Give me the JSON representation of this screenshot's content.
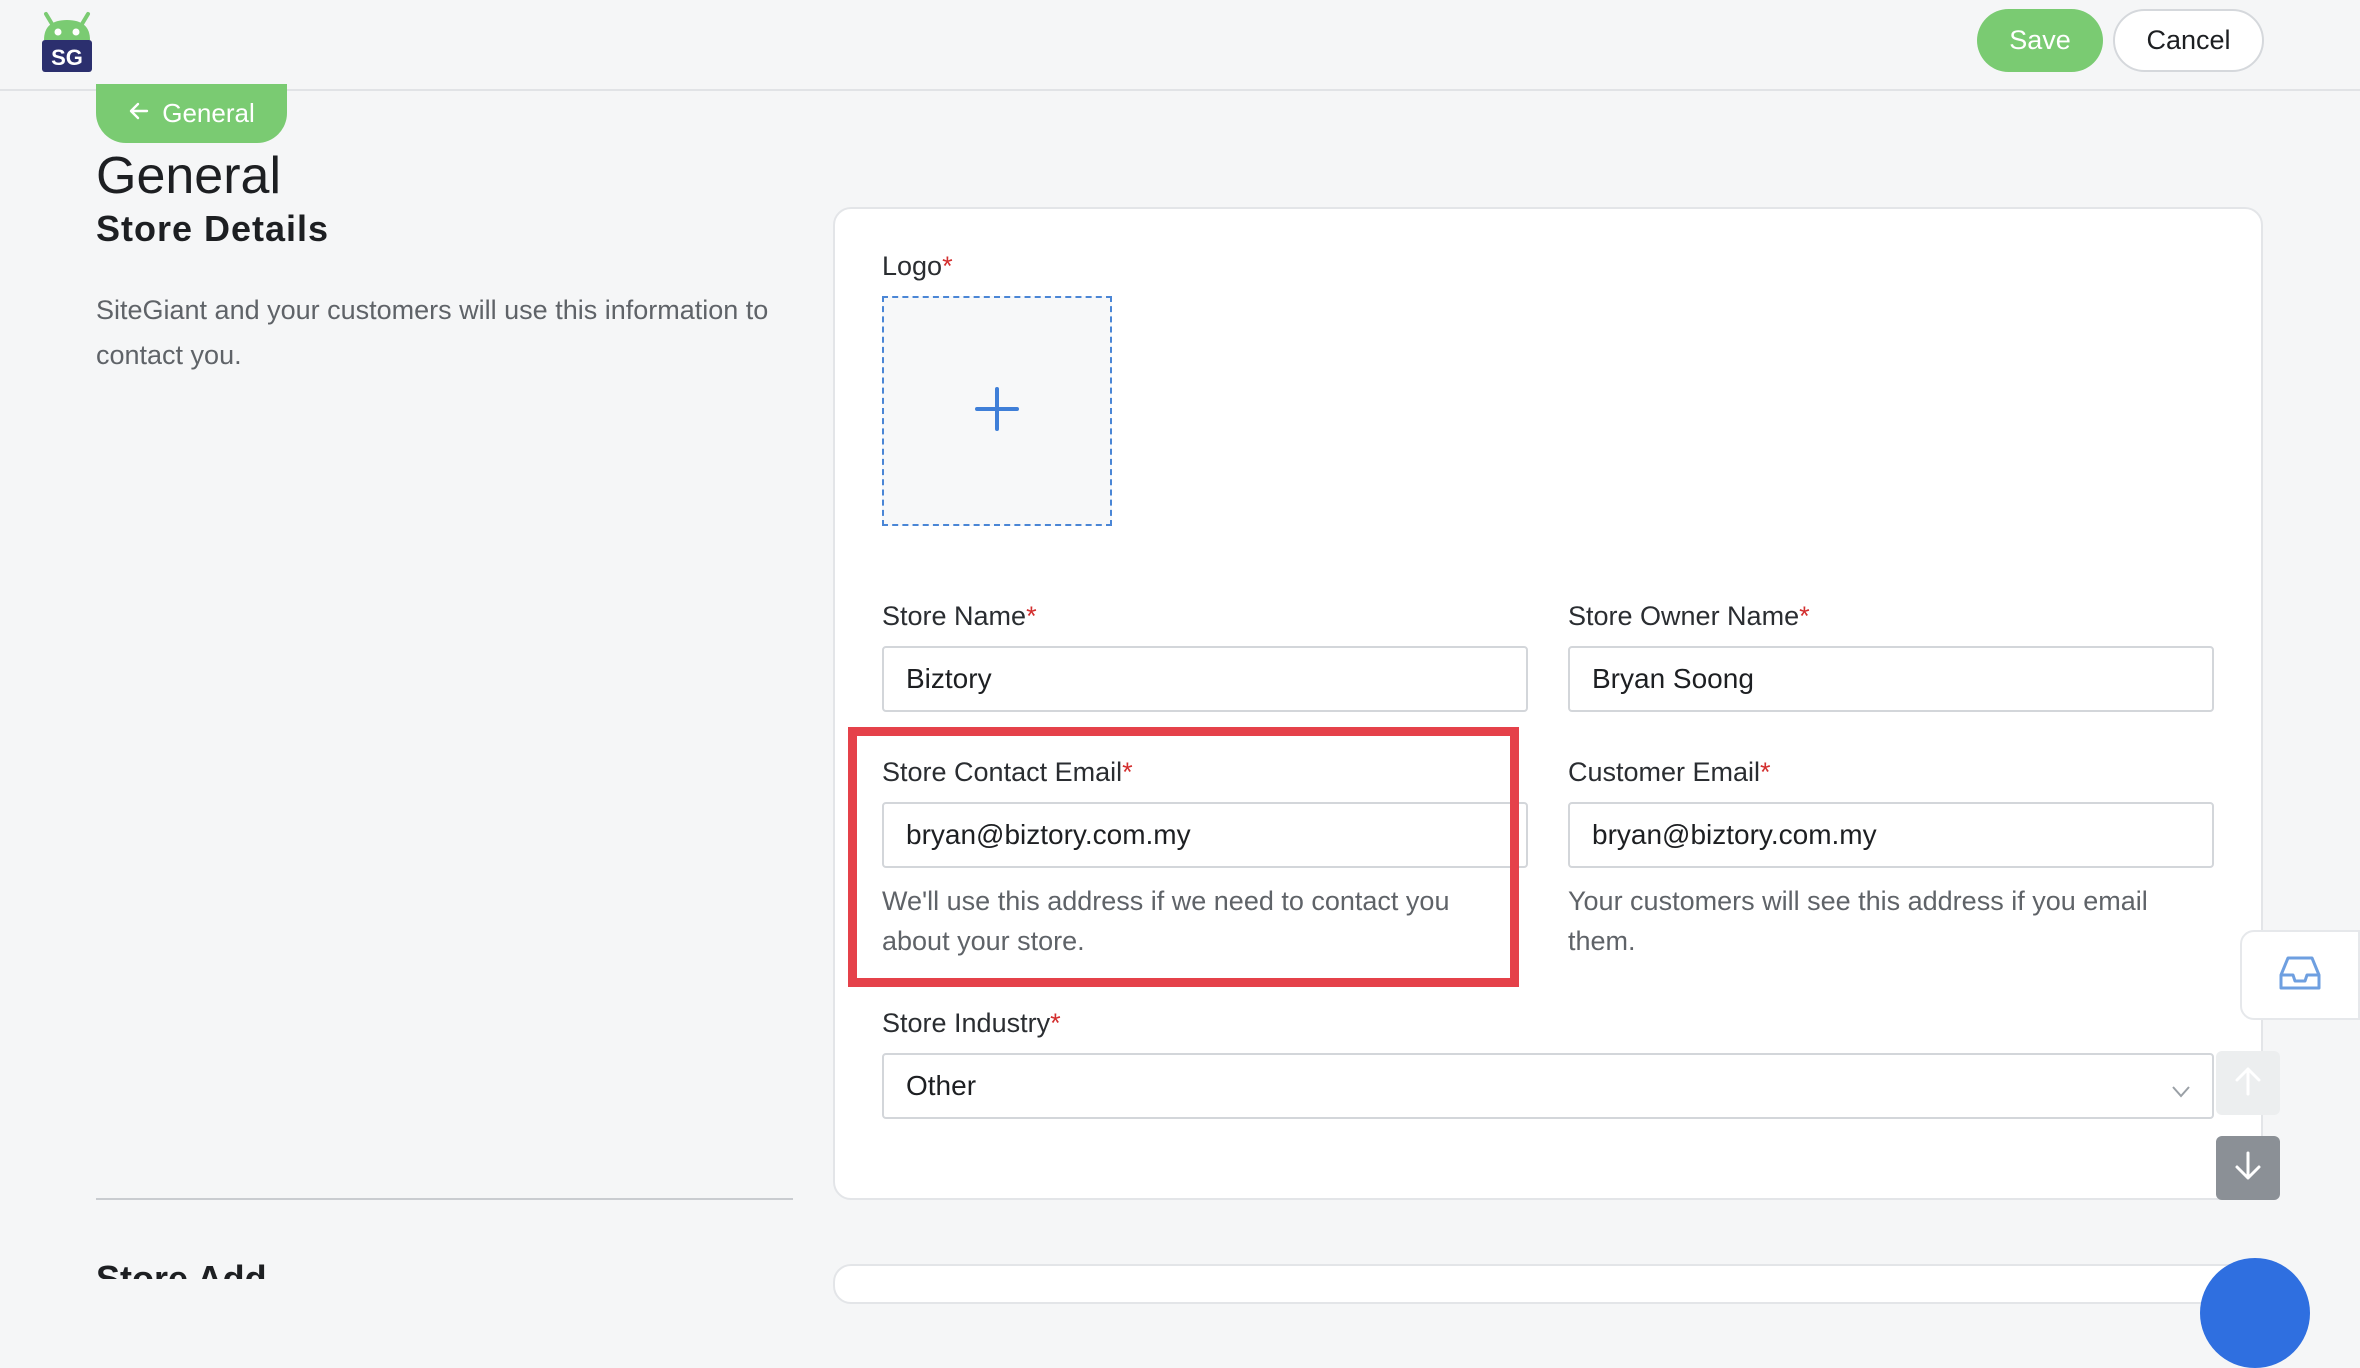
{
  "header": {
    "save_label": "Save",
    "cancel_label": "Cancel"
  },
  "breadcrumb": {
    "back_label": "General"
  },
  "page": {
    "title": "General",
    "section_title": "Store Details",
    "section_description": "SiteGiant and your customers will use this information to contact you.",
    "next_section_title": "Store Add"
  },
  "form": {
    "logo_label": "Logo",
    "required_mark": "*",
    "store_name": {
      "label": "Store Name",
      "value": "Biztory"
    },
    "store_owner_name": {
      "label": "Store Owner Name",
      "value": "Bryan Soong"
    },
    "store_contact_email": {
      "label": "Store Contact Email",
      "value": "bryan@biztory.com.my",
      "help": "We'll use this address if we need to contact you about your store."
    },
    "customer_email": {
      "label": "Customer Email",
      "value": "bryan@biztory.com.my",
      "help": "Your customers will see this address if you email them."
    },
    "store_industry": {
      "label": "Store Industry",
      "value": "Other"
    }
  },
  "colors": {
    "accent_green": "#7acb72",
    "required_red": "#d32f2f",
    "highlight_red": "#e5414a",
    "link_blue": "#2f6fe0"
  },
  "icons": {
    "app_logo": "sitegiant-logo",
    "back": "arrow-left-icon",
    "upload": "plus-icon",
    "dropdown": "chevron-down-icon",
    "inbox": "inbox-icon",
    "scroll_up": "arrow-up-icon",
    "scroll_down": "arrow-down-icon"
  }
}
